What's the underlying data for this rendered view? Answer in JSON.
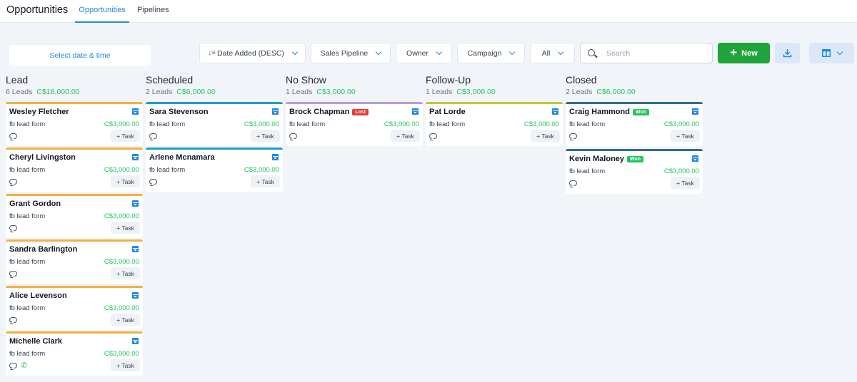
{
  "header": {
    "title": "Opportunities",
    "tabs": [
      {
        "label": "Opportunities",
        "active": true
      },
      {
        "label": "Pipelines",
        "active": false
      }
    ]
  },
  "toolbar": {
    "date_placeholder": "Select date & time",
    "sort_label": "Date Added (DESC)",
    "pipeline_label": "Sales Pipeline",
    "owner_label": "Owner",
    "campaign_label": "Campaign",
    "status_label": "All",
    "search_placeholder": "Search",
    "new_label": "New"
  },
  "columns": [
    {
      "title": "Lead",
      "count": "6 Leads",
      "amount": "C$18,000.00",
      "cards": [
        {
          "name": "Wesley Fletcher",
          "source": "fb lead form",
          "value": "C$3,000.00",
          "task": "+ Task"
        },
        {
          "name": "Cheryl Livingston",
          "source": "fb lead form",
          "value": "C$3,000.00",
          "task": "+ Task"
        },
        {
          "name": "Grant Gordon",
          "source": "fb lead form",
          "value": "C$3,000.00",
          "task": "+ Task"
        },
        {
          "name": "Sandra Barlington",
          "source": "fb lead form",
          "value": "C$3,000.00",
          "task": "+ Task"
        },
        {
          "name": "Alice Levenson",
          "source": "fb lead form",
          "value": "C$3,000.00",
          "task": "+ Task"
        },
        {
          "name": "Michelle Clark",
          "source": "fb lead form",
          "value": "C$3,000.00",
          "task": "+ Task"
        }
      ]
    },
    {
      "title": "Scheduled",
      "count": "2 Leads",
      "amount": "C$6,000.00",
      "cards": [
        {
          "name": "Sara Stevenson",
          "source": "fb lead form",
          "value": "C$3,000.00",
          "task": "+ Task"
        },
        {
          "name": "Arlene Mcnamara",
          "source": "fb lead form",
          "value": "C$3,000.00",
          "task": "+ Task"
        }
      ]
    },
    {
      "title": "No Show",
      "count": "1 Leads",
      "amount": "C$3,000.00",
      "cards": [
        {
          "name": "Brock Chapman",
          "badge": "Lost",
          "source": "fb lead form",
          "value": "C$3,000.00",
          "task": "+ Task"
        }
      ]
    },
    {
      "title": "Follow-Up",
      "count": "1 Leads",
      "amount": "C$3,000.00",
      "cards": [
        {
          "name": "Pat Lorde",
          "source": "fb lead form",
          "value": "C$3,000.00",
          "task": "+ Task"
        }
      ]
    },
    {
      "title": "Closed",
      "count": "2 Leads",
      "amount": "C$6,000.00",
      "cards": [
        {
          "name": "Craig Hammond",
          "badge": "Won",
          "source": "fb lead form",
          "value": "C$3,000.00",
          "task": "+ Task"
        },
        {
          "name": "Kevin Maloney",
          "badge": "Won",
          "source": "fb lead form",
          "value": "C$3,000.00",
          "task": "+ Task"
        }
      ]
    }
  ],
  "colors": {
    "accent": "#1e88e5",
    "new_button": "#20a33a",
    "amount_green": "#22c55e",
    "lost_red": "#e53935"
  }
}
